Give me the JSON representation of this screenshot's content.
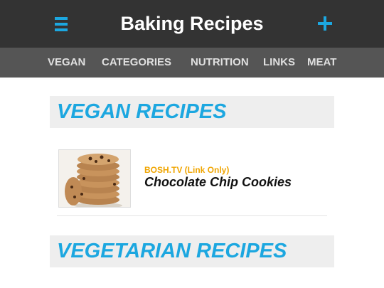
{
  "header": {
    "title": "Baking Recipes",
    "menu_icon": "hamburger-menu-icon",
    "add_icon": "plus-icon",
    "accent_color": "#1ca7e0"
  },
  "nav": {
    "items": [
      {
        "label": "VEGAN"
      },
      {
        "label": "CATEGORIES"
      },
      {
        "label": "NUTRITION"
      },
      {
        "label": "LINKS"
      },
      {
        "label": "MEAT"
      }
    ]
  },
  "sections": [
    {
      "title": "VEGAN RECIPES",
      "recipes": [
        {
          "source": "BOSH.TV (Link Only)",
          "title": "Chocolate Chip Cookies",
          "image": "cookie-stack-photo"
        }
      ]
    },
    {
      "title": "VEGETARIAN RECIPES"
    }
  ]
}
